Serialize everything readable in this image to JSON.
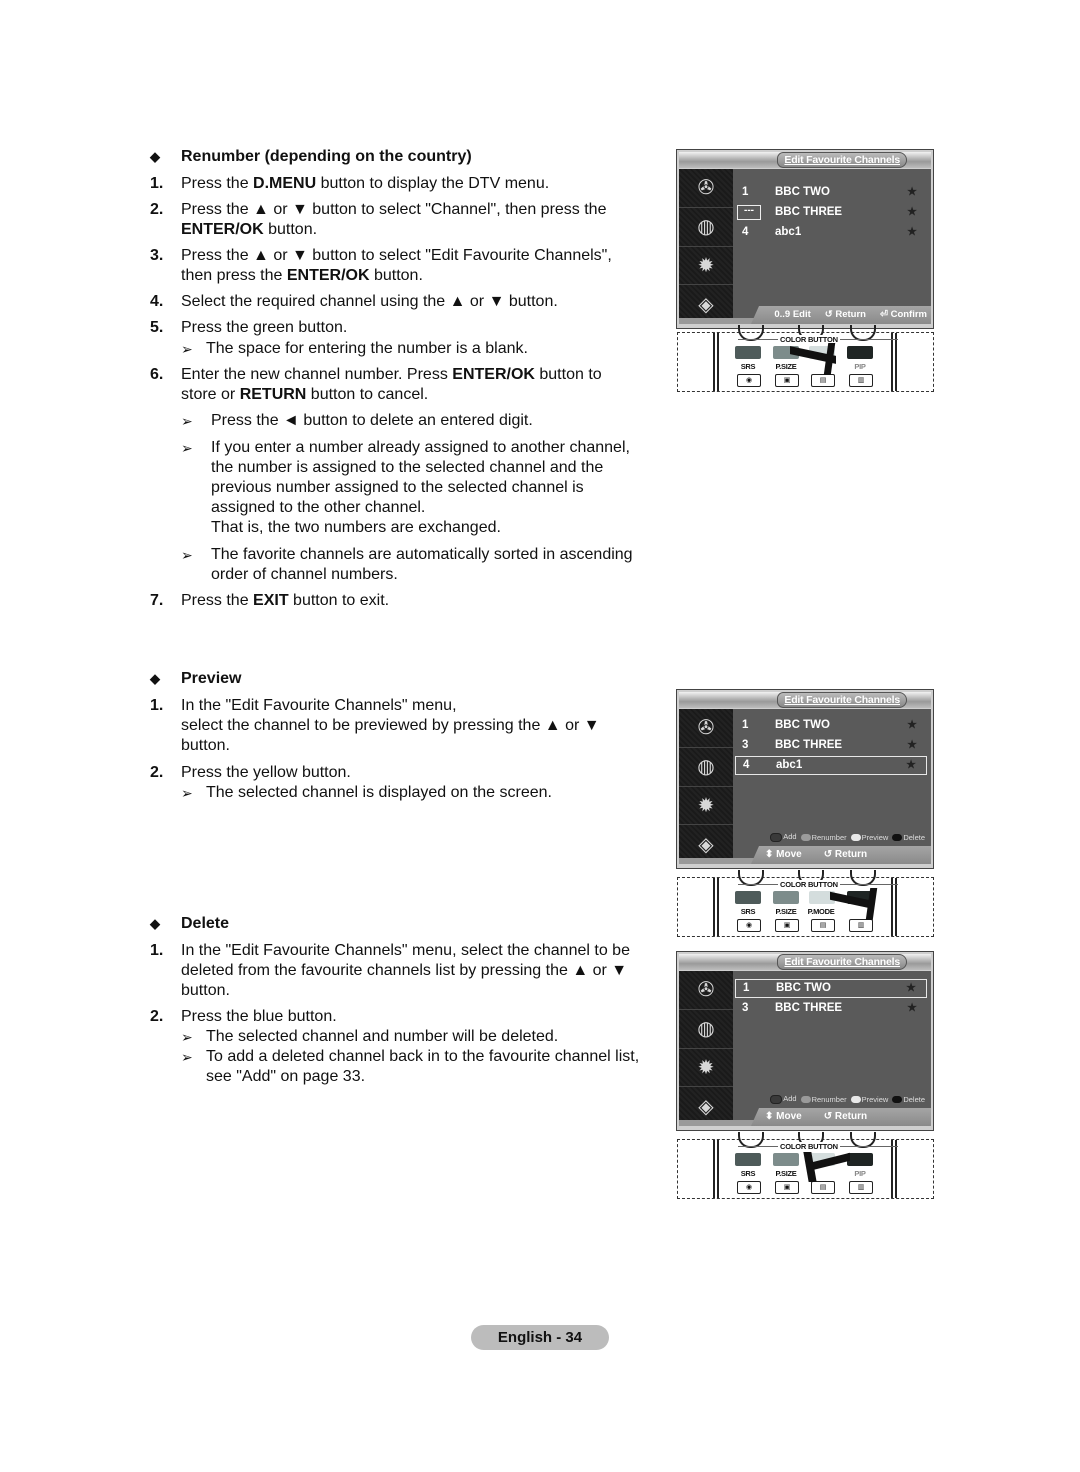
{
  "renumber": {
    "heading": "Renumber (depending on the country)",
    "steps": [
      {
        "num": "1.",
        "pre": "Press the ",
        "bold": "D.MENU",
        "post": " button to display the DTV menu."
      },
      {
        "num": "2.",
        "pre": "Press the ▲ or ▼ button to select \"Channel\", then press the ",
        "bold": "ENTER/OK",
        "post": " button."
      },
      {
        "num": "3.",
        "pre": "Press the ▲ or ▼ button to select \"Edit Favourite Channels\", then press the ",
        "bold": "ENTER/OK",
        "post": " button."
      },
      {
        "num": "4.",
        "text": "Select the required channel using the ▲ or ▼ button."
      },
      {
        "num": "5.",
        "text": "Press the green button."
      },
      {
        "num": "6.",
        "pre": "Enter the new channel number. Press ",
        "bold": "ENTER/OK",
        "mid": " button to store or ",
        "bold2": "RETURN",
        "post": " button to cancel."
      },
      {
        "num": "7.",
        "pre": "Press the ",
        "bold": "EXIT",
        "post": " button to exit."
      }
    ],
    "notes": [
      "The space for entering the number is a blank.",
      "Press the ◄ button to delete an entered digit.",
      "If you enter a number already assigned to another channel, the number is assigned to the selected channel and the previous number assigned to the selected channel is assigned to the other channel.",
      "That is, the two numbers are exchanged.",
      "The favorite channels are automatically sorted in ascending order of channel numbers."
    ]
  },
  "preview": {
    "heading": "Preview",
    "steps": [
      {
        "num": "1.",
        "text": "In the \"Edit Favourite Channels\" menu,",
        "text2": "select the channel to be previewed by pressing the ▲ or ▼ button."
      },
      {
        "num": "2.",
        "text": "Press the yellow button."
      }
    ],
    "notes": [
      "The selected channel is displayed on the screen."
    ]
  },
  "delete": {
    "heading": "Delete",
    "steps": [
      {
        "num": "1.",
        "text": "In the \"Edit Favourite Channels\" menu, select the channel to be deleted from the favourite channels list by pressing the ▲ or ▼ button."
      },
      {
        "num": "2.",
        "text": "Press the blue button."
      }
    ],
    "notes": [
      "The selected channel and number will be deleted.",
      "To add a deleted channel back in to the favourite channel list, see \"Add\" on page 33."
    ]
  },
  "symbols": {
    "diamond": "◆",
    "arrow": "➢"
  },
  "osd_screens": [
    {
      "title": "Edit Favourite Channels",
      "channels": [
        {
          "num": "1",
          "name": "BBC TWO",
          "star": "★"
        },
        {
          "num": "---",
          "name": "BBC THREE",
          "star": "★",
          "blank": true
        },
        {
          "num": "4",
          "name": "abc1",
          "star": "★"
        }
      ],
      "footer": {
        "edit": "0..9 Edit",
        "return": "↺ Return",
        "confirm": "⏎ Confirm"
      }
    },
    {
      "title": "Edit Favourite Channels",
      "channels": [
        {
          "num": "1",
          "name": "BBC TWO",
          "star": "★"
        },
        {
          "num": "3",
          "name": "BBC THREE",
          "star": "★"
        },
        {
          "num": "4",
          "name": "abc1",
          "star": "★",
          "selected": true
        }
      ],
      "legend": [
        "Add",
        "Renumber",
        "Preview",
        "Delete"
      ],
      "footer": {
        "move": "⬍ Move",
        "return": "↺ Return"
      }
    },
    {
      "title": "Edit Favourite Channels",
      "channels": [
        {
          "num": "1",
          "name": "BBC TWO",
          "star": "★",
          "selected": true
        },
        {
          "num": "3",
          "name": "BBC THREE",
          "star": "★"
        }
      ],
      "legend": [
        "Add",
        "Renumber",
        "Preview",
        "Delete"
      ],
      "footer": {
        "move": "⬍ Move",
        "return": "↺ Return"
      }
    }
  ],
  "remote": {
    "color_button_label": "COLOR BUTTON",
    "function_labels": [
      "SRS",
      "P.SIZE",
      "P.MODE",
      "PIP"
    ],
    "color_buttons": [
      "#4e5b5a",
      "#7d8c8b",
      "#d4dddd",
      "#1f2524"
    ]
  },
  "legend_colors": {
    "add": "#3a3a3a",
    "renumber": "#9a9a9a",
    "preview": "#e8e8e8",
    "delete": "#111111"
  },
  "page_footer": "English - 34"
}
